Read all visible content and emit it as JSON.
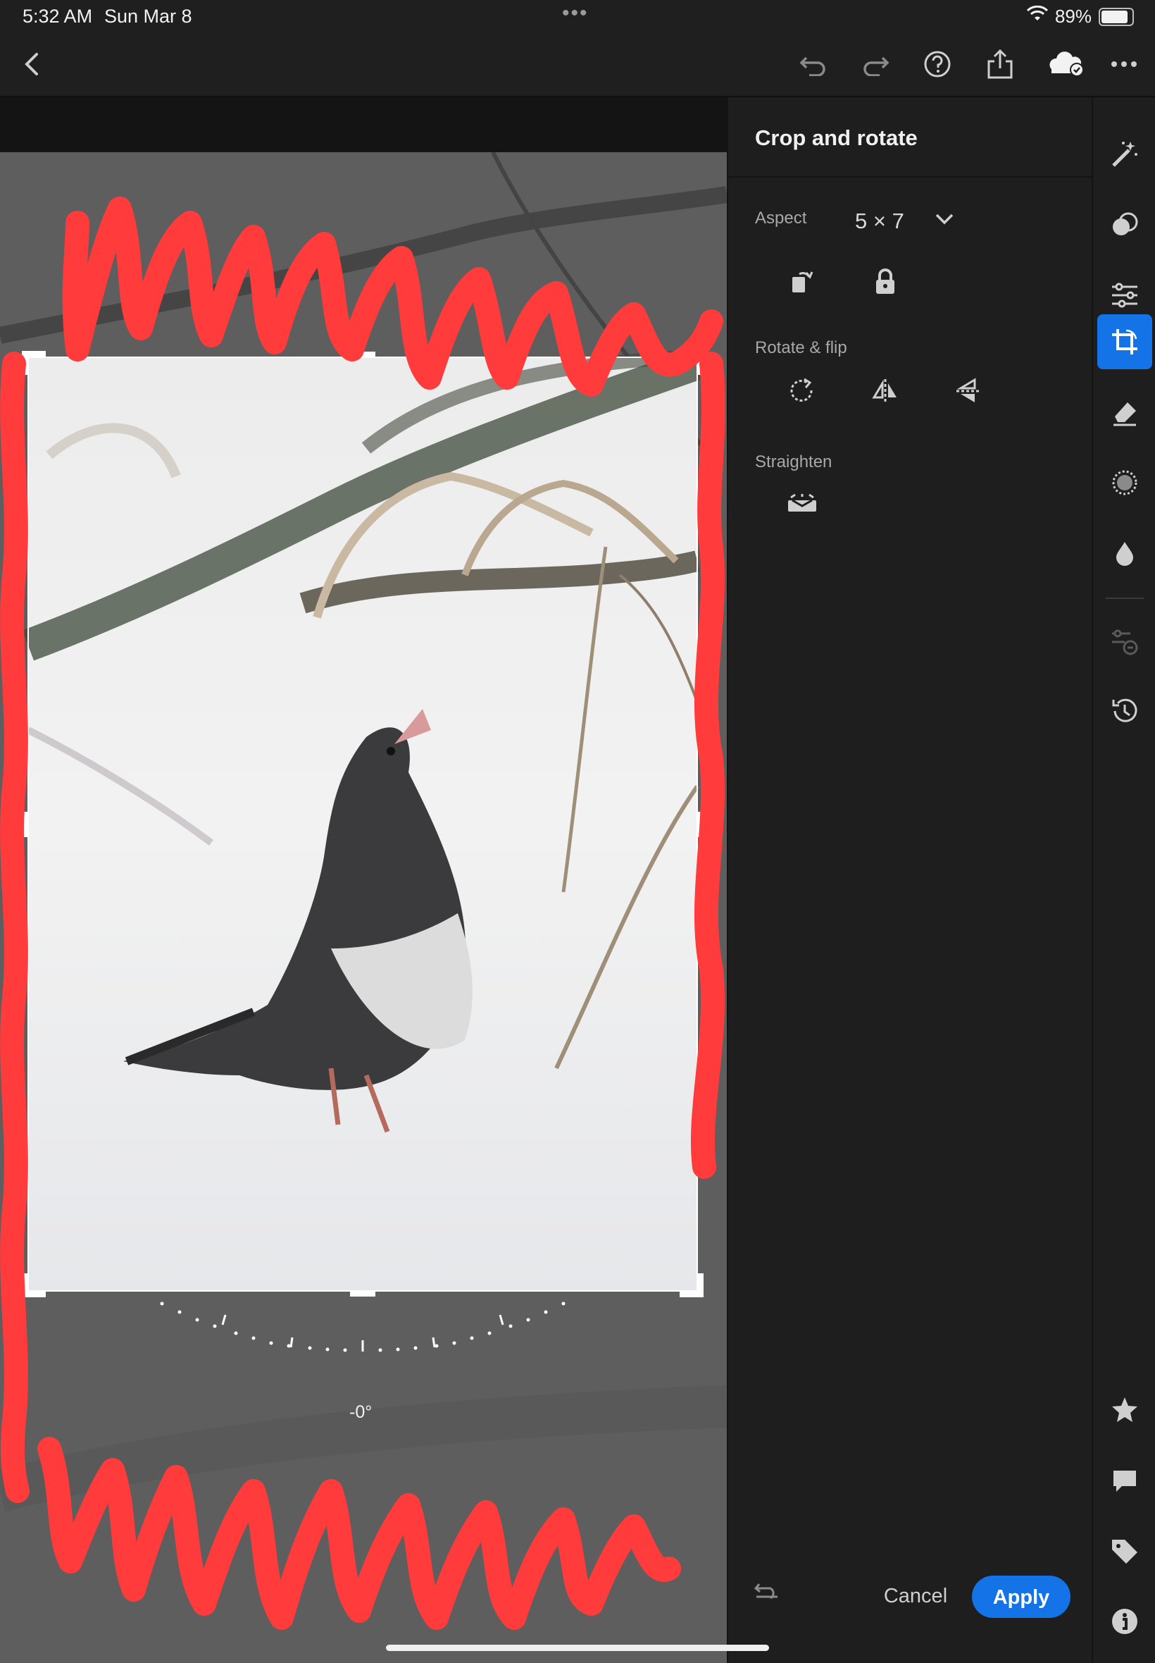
{
  "status_bar": {
    "time": "5:32 AM",
    "date": "Sun Mar 8",
    "dots": "•••",
    "battery_percent": "89%",
    "battery_level": 0.89
  },
  "toolbar": {
    "icons": [
      "back-icon",
      "undo-icon",
      "redo-icon",
      "help-icon",
      "share-icon",
      "cloud-synced-icon",
      "more-icon"
    ]
  },
  "panel": {
    "title": "Crop and rotate",
    "aspect_label": "Aspect",
    "aspect_value": "5 × 7",
    "rotate_label": "Rotate & flip",
    "straighten_label": "Straighten"
  },
  "canvas": {
    "angle_label": "-0°"
  },
  "actions": {
    "cancel_label": "Cancel",
    "apply_label": "Apply"
  },
  "colors": {
    "accent": "#1473e6",
    "panel_bg": "#1e1e1e",
    "scribble": "#ff3b3b"
  }
}
